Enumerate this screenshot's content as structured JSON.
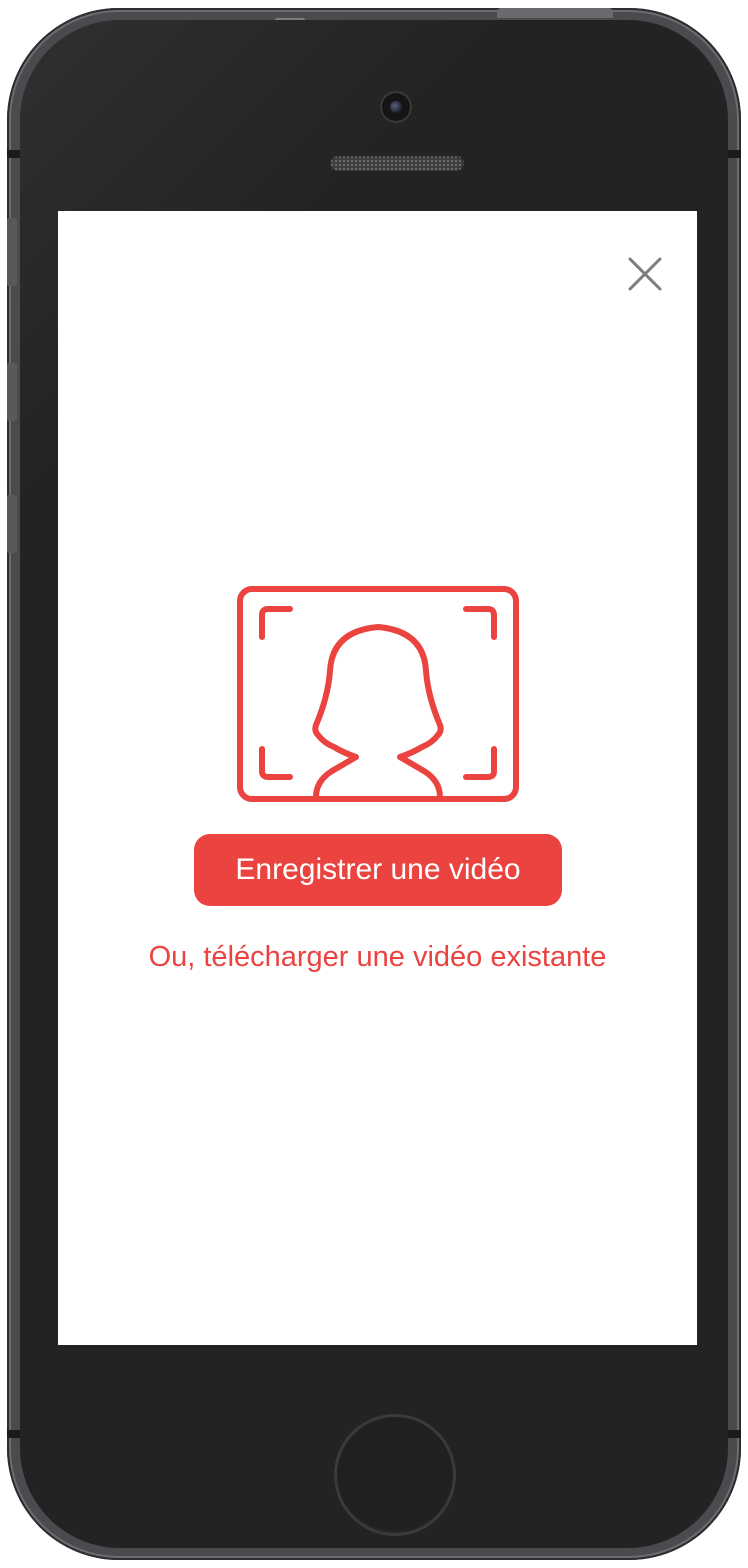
{
  "device": {
    "type": "smartphone",
    "frame_color": "#232323",
    "screen_color": "#ffffff"
  },
  "modal": {
    "close_icon": "close-icon",
    "illustration_icon": "selfie-frame-icon",
    "accent_color": "#ea4340",
    "record_button_label": "Enregistrer une vidéo",
    "upload_link_label": "Ou, télécharger une vidéo existante"
  }
}
